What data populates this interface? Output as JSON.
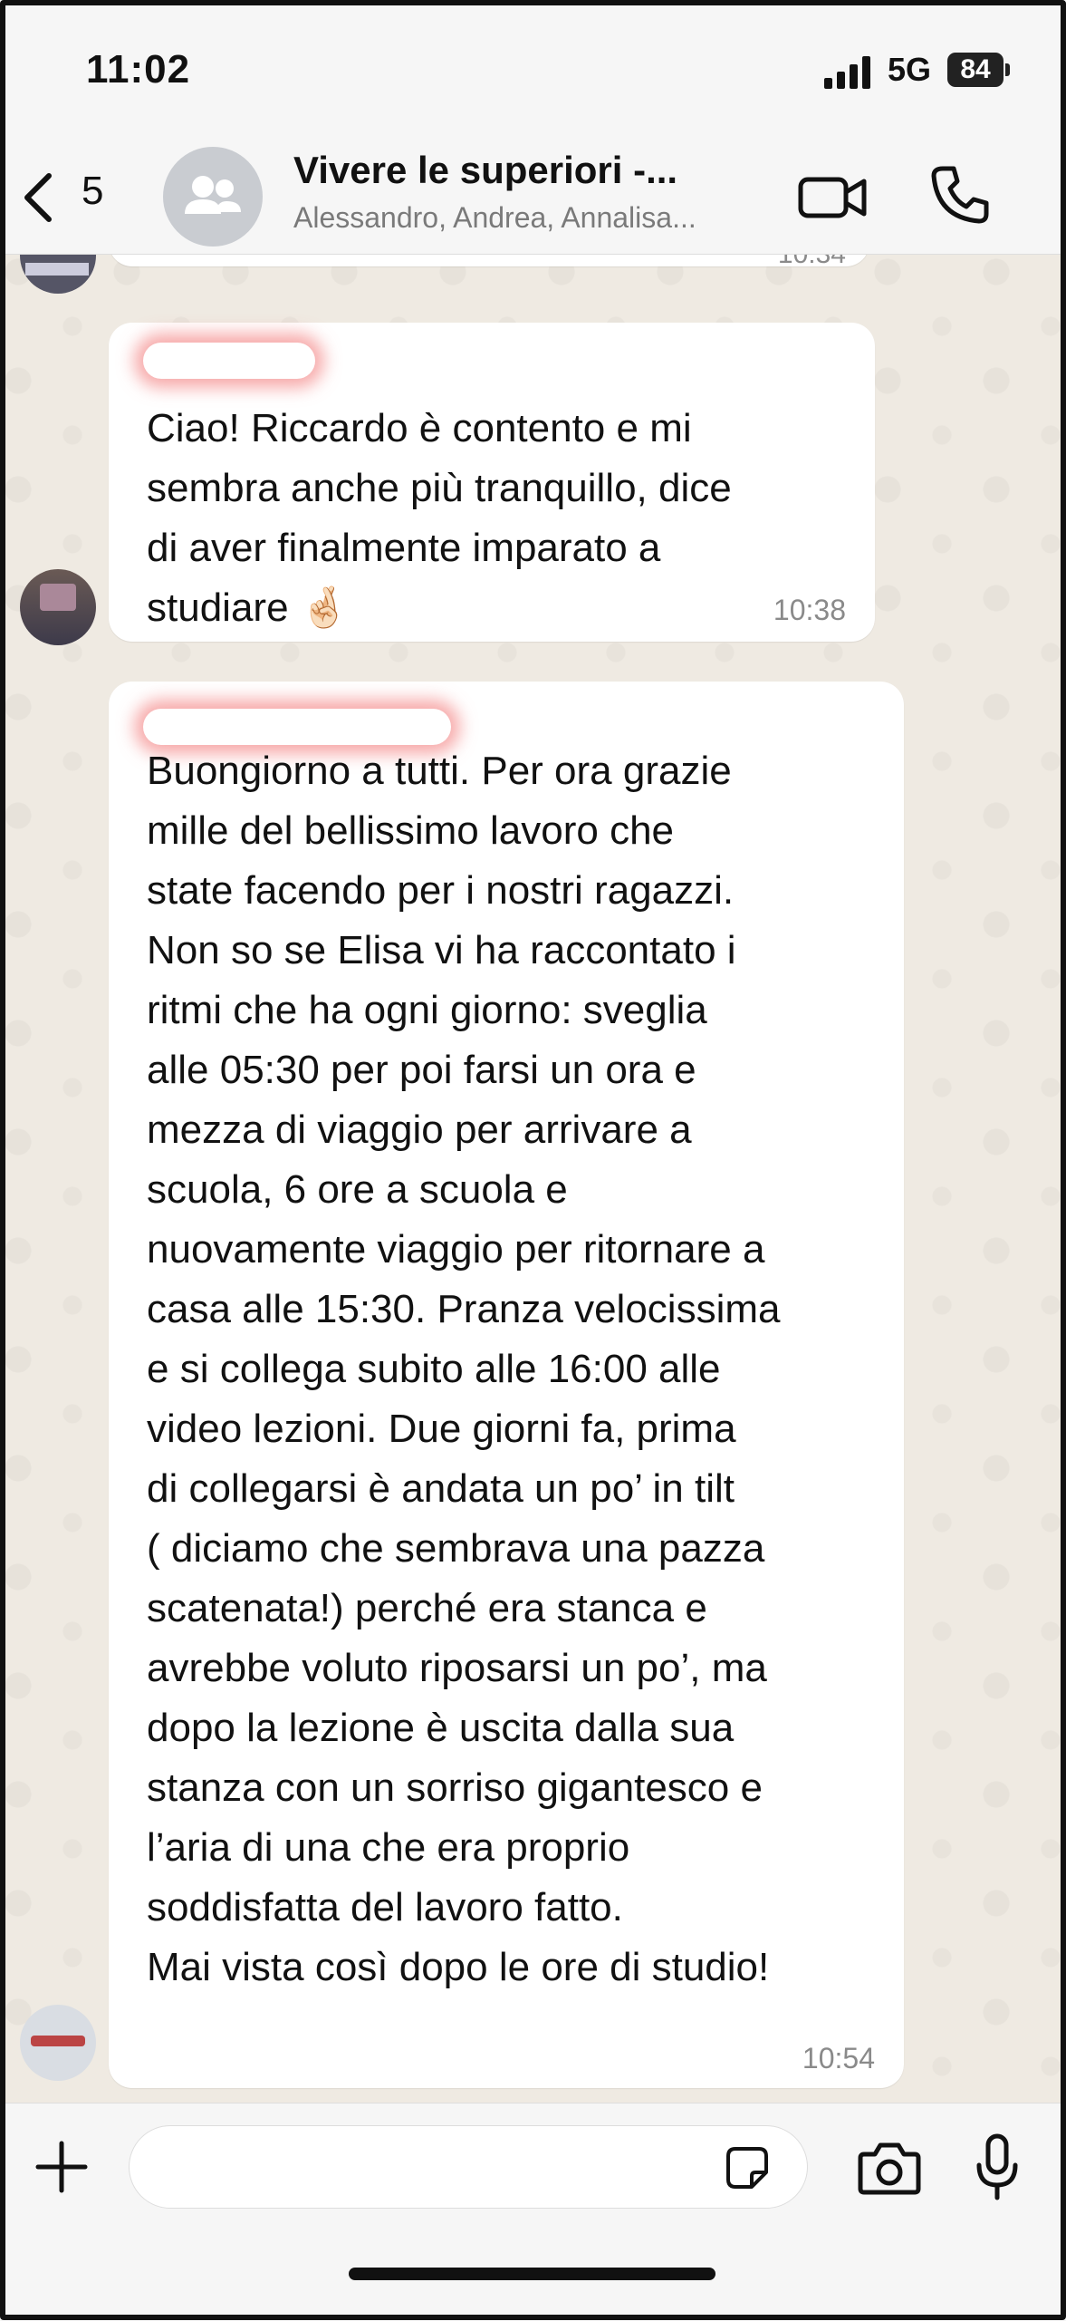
{
  "status_bar": {
    "time": "11:02",
    "network": "5G",
    "battery": "84"
  },
  "header": {
    "back_count": "5",
    "title": "Vivere le superiori -...",
    "subtitle": "Alessandro, Andrea, Annalisa..."
  },
  "messages": [
    {
      "text": "Ciao! Riccardo è contento e mi\nsembra anche più tranquillo, dice\ndi aver finalmente imparato a\nstudiare 🤞🏻",
      "time": "10:38"
    },
    {
      "text": "Buongiorno a tutti. Per ora grazie\nmille del bellissimo lavoro che\nstate facendo per i nostri ragazzi.\nNon so se Elisa vi ha raccontato i\nritmi che ha ogni giorno: sveglia\nalle 05:30 per poi farsi un ora e\nmezza di viaggio per arrivare a\nscuola, 6 ore a scuola e\nnuovamente viaggio per ritornare a\ncasa alle 15:30. Pranza velocissima\ne si collega subito alle 16:00 alle\nvideo lezioni. Due giorni fa, prima\ndi collegarsi è andata un po’ in tilt\n( diciamo che sembrava una pazza\nscatenata!) perché era stanca e\navrebbe voluto riposarsi un po’, ma\ndopo la lezione è uscita dalla sua\nstanza con un sorriso gigantesco e\nl’aria di una che era proprio\nsoddisfatta del lavoro fatto.\nMai vista così dopo le ore di studio!",
      "time": "10:54"
    }
  ],
  "previous_message": {
    "time": "10:34"
  },
  "input": {
    "value": ""
  },
  "icons": {
    "back": "chevron-left-icon",
    "group_avatar": "group-icon",
    "video": "video-camera-icon",
    "call": "phone-icon",
    "plus": "plus-icon",
    "sticker": "sticker-icon",
    "camera": "camera-icon",
    "mic": "microphone-icon"
  },
  "colors": {
    "chat_background": "#efeae2",
    "bubble": "#ffffff",
    "bar_background": "#f6f6f6",
    "timestamp": "#8a8a8a"
  }
}
